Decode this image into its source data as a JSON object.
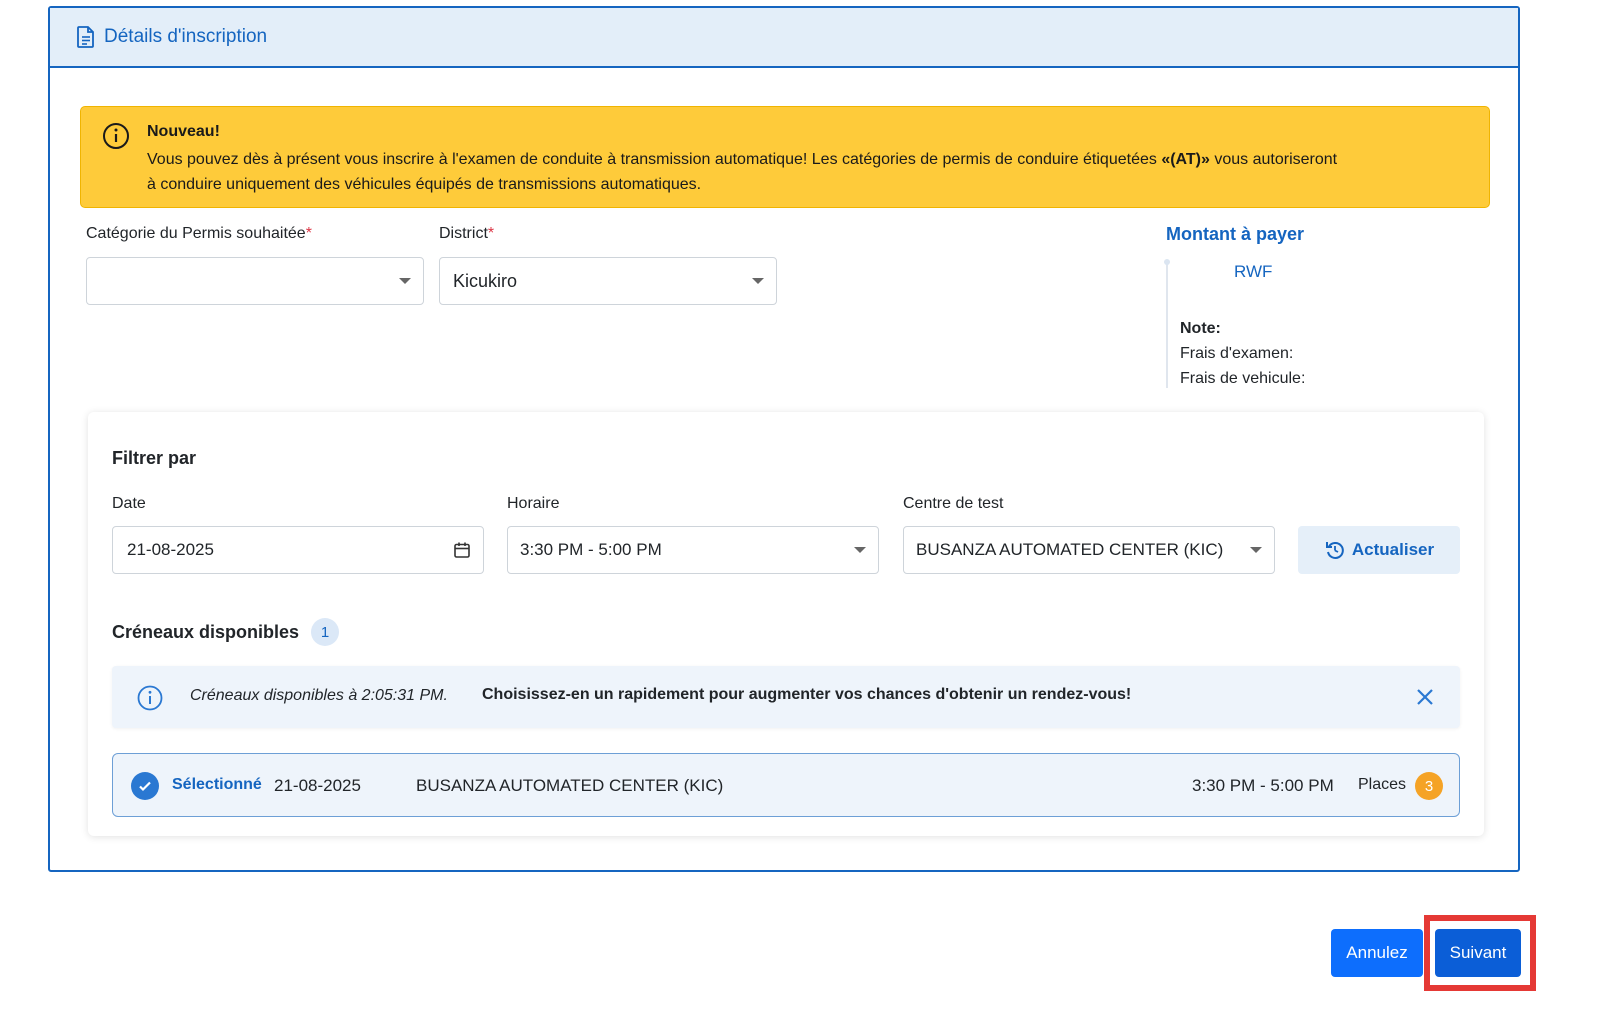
{
  "header": {
    "title": "Détails d'inscription"
  },
  "alert": {
    "title": "Nouveau!",
    "text_before": "Vous pouvez dès à présent vous inscrire à l'examen de conduite à transmission automatique! Les catégories de permis de conduire étiquetées ",
    "text_bold": "«(AT)»",
    "text_after": " vous autoriseront à conduire uniquement des véhicules équipés de transmissions automatiques."
  },
  "form": {
    "category_label": "Catégorie du Permis souhaitée",
    "category_value": "",
    "district_label": "District",
    "district_value": "Kicukiro",
    "required_mark": "*"
  },
  "amount": {
    "title": "Montant à payer",
    "currency": "RWF",
    "note_title": "Note:",
    "exam_fee_label": "Frais d'examen:",
    "vehicle_fee_label": "Frais de vehicule:"
  },
  "filter": {
    "title": "Filtrer par",
    "date_label": "Date",
    "date_value": "21-08-2025",
    "schedule_label": "Horaire",
    "schedule_value": "3:30 PM - 5:00 PM",
    "center_label": "Centre de test",
    "center_value": "BUSANZA AUTOMATED CENTER (KIC)",
    "refresh_label": "Actualiser"
  },
  "slots": {
    "title": "Créneaux disponibles",
    "count": "1",
    "info_text": "Créneaux disponibles à 2:05:31 PM.",
    "info_bold": "Choisissez-en un rapidement pour augmenter vos chances d'obtenir un rendez-vous!",
    "items": [
      {
        "status": "Sélectionné",
        "date": "21-08-2025",
        "center": "BUSANZA AUTOMATED CENTER (KIC)",
        "time": "3:30 PM - 5:00 PM",
        "places_label": "Places",
        "places": "3"
      }
    ]
  },
  "actions": {
    "cancel_label": "Annulez",
    "next_label": "Suivant"
  },
  "colors": {
    "primary": "#1565c0",
    "alert_bg": "#fecb3a",
    "highlight": "#e53935",
    "places_badge": "#f5a326"
  }
}
